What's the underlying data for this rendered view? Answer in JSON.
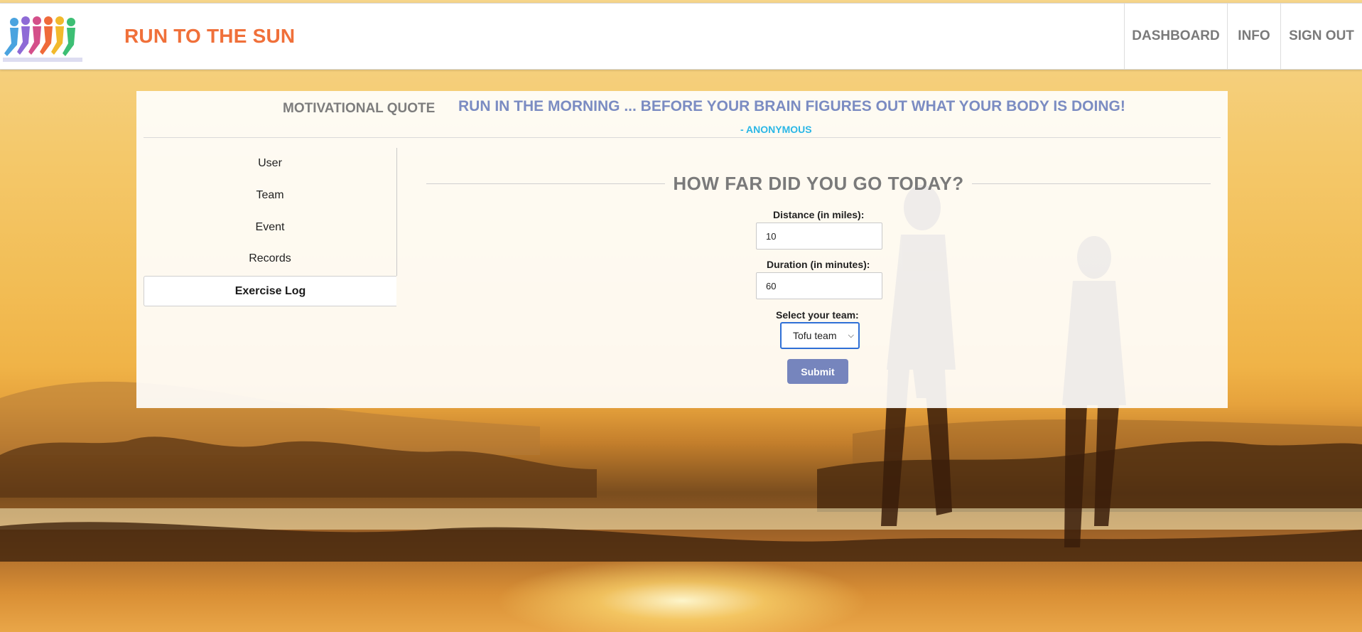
{
  "header": {
    "brand": "RUN TO THE SUN",
    "nav": {
      "dashboard": "DASHBOARD",
      "info": "INFO",
      "sign_out": "SIGN OUT"
    }
  },
  "quote": {
    "label": "MOTIVATIONAL QUOTE",
    "text": "RUN IN THE MORNING ... BEFORE YOUR BRAIN FIGURES OUT WHAT YOUR BODY IS DOING!",
    "author": "- ANONYMOUS"
  },
  "sidebar": {
    "items": [
      {
        "label": "User"
      },
      {
        "label": "Team"
      },
      {
        "label": "Event"
      },
      {
        "label": "Records"
      },
      {
        "label": "Exercise Log",
        "active": true
      }
    ]
  },
  "form": {
    "title": "HOW FAR DID YOU GO TODAY?",
    "distance_label": "Distance (in miles):",
    "distance_value": "10",
    "duration_label": "Duration (in minutes):",
    "duration_value": "60",
    "team_label": "Select your team:",
    "team_selected": "Tofu team",
    "submit_label": "Submit"
  },
  "colors": {
    "brand": "#f0703a",
    "quote_text": "#7b8cc2",
    "quote_author": "#2bb7e6",
    "submit_bg": "#7685bd",
    "select_border": "#2f6fd6"
  }
}
